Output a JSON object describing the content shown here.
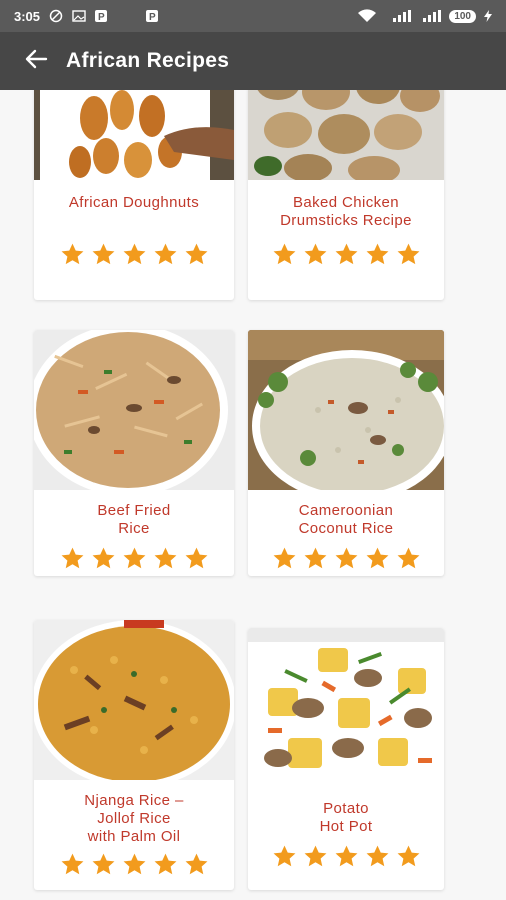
{
  "status_bar": {
    "time": "3:05",
    "battery": "100",
    "icons": [
      "do-not-disturb-icon",
      "image-icon",
      "parking-icon",
      "parking-icon",
      "wifi-icon",
      "signal-icon",
      "signal-icon",
      "charging-icon"
    ]
  },
  "app_bar": {
    "back_icon": "arrow-left-icon",
    "title": "African Recipes"
  },
  "colors": {
    "status_bar": "#5a5a5a",
    "app_bar": "#474747",
    "title_text": "#c0392b",
    "star": "#f29b1d"
  },
  "recipes": [
    {
      "title": "African Doughnuts",
      "rating": 5
    },
    {
      "title": "Baked Chicken\nDrumsticks Recipe",
      "rating": 5
    },
    {
      "title": "Beef Fried\nRice",
      "rating": 5
    },
    {
      "title": "Cameroonian\nCoconut Rice",
      "rating": 5
    },
    {
      "title": "Njanga Rice –\nJollof Rice\nwith Palm Oil",
      "rating": 5
    },
    {
      "title": "Potato\nHot Pot",
      "rating": 5
    }
  ]
}
